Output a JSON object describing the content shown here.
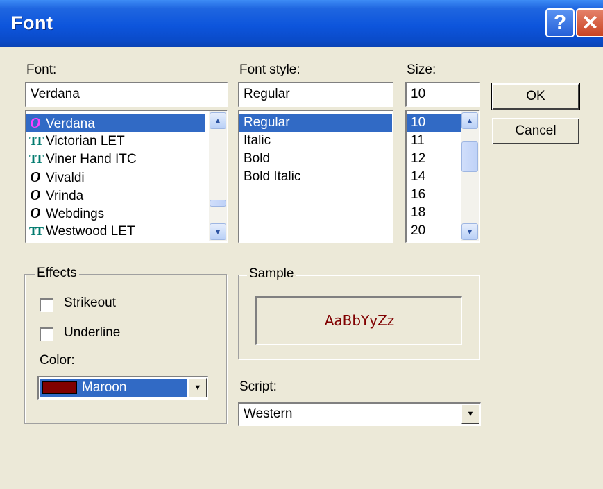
{
  "window": {
    "title": "Font",
    "help_glyph": "?",
    "close_glyph": "✕"
  },
  "font": {
    "label": "Font:",
    "value": "Verdana",
    "items": [
      {
        "label": "Verdana",
        "icon": "O",
        "type": "opentype"
      },
      {
        "label": "Victorian LET",
        "icon": "TT",
        "type": "truetype"
      },
      {
        "label": "Viner Hand ITC",
        "icon": "TT",
        "type": "truetype"
      },
      {
        "label": "Vivaldi",
        "icon": "O",
        "type": "opentype"
      },
      {
        "label": "Vrinda",
        "icon": "O",
        "type": "opentype"
      },
      {
        "label": "Webdings",
        "icon": "O",
        "type": "opentype"
      },
      {
        "label": "Westwood LET",
        "icon": "TT",
        "type": "truetype"
      }
    ]
  },
  "style": {
    "label": "Font style:",
    "value": "Regular",
    "items": [
      "Regular",
      "Italic",
      "Bold",
      "Bold Italic"
    ]
  },
  "size": {
    "label": "Size:",
    "value": "10",
    "items": [
      "10",
      "11",
      "12",
      "14",
      "16",
      "18",
      "20"
    ]
  },
  "buttons": {
    "ok": "OK",
    "cancel": "Cancel"
  },
  "effects": {
    "label": "Effects",
    "strikeout": "Strikeout",
    "underline": "Underline",
    "color_label": "Color:",
    "color_value": "Maroon",
    "color_swatch": "#800000"
  },
  "sample": {
    "label": "Sample",
    "text": "AaBbYyZz",
    "color": "#800000"
  },
  "script": {
    "label": "Script:",
    "value": "Western"
  },
  "colors": {
    "title_bar": "#0a4bc9",
    "selection": "#316ac5",
    "face": "#ece9d8"
  }
}
